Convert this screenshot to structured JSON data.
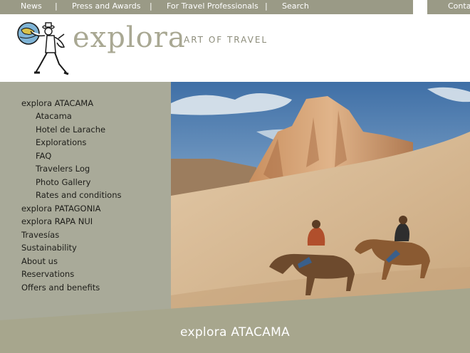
{
  "top_nav": {
    "items": [
      "News",
      "Press and Awards",
      "For Travel Professionals",
      "Search"
    ],
    "separator": "|",
    "contact": "Conta"
  },
  "header": {
    "brand": "explora",
    "tagline": "ART OF TRAVEL"
  },
  "sidebar": {
    "items": [
      {
        "label": "explora ATACAMA",
        "level": 0
      },
      {
        "label": "Atacama",
        "level": 1
      },
      {
        "label": "Hotel de Larache",
        "level": 1
      },
      {
        "label": "Explorations",
        "level": 1
      },
      {
        "label": "FAQ",
        "level": 1
      },
      {
        "label": "Travelers Log",
        "level": 1
      },
      {
        "label": "Photo Gallery",
        "level": 1
      },
      {
        "label": "Rates and conditions",
        "level": 1
      },
      {
        "label": "explora PATAGONIA",
        "level": 0
      },
      {
        "label": "explora RAPA NUI",
        "level": 0
      },
      {
        "label": "Travesías",
        "level": 0
      },
      {
        "label": "Sustainability",
        "level": 0
      },
      {
        "label": "About us",
        "level": 0
      },
      {
        "label": "Reservations",
        "level": 0
      },
      {
        "label": "Offers and benefits",
        "level": 0
      }
    ]
  },
  "footer": {
    "title": "explora ATACAMA"
  },
  "colors": {
    "nav_bar": "#9a9a86",
    "sidebar": "#a9aa99",
    "brand": "#a9a893",
    "footer_band": "#a7a68d"
  }
}
